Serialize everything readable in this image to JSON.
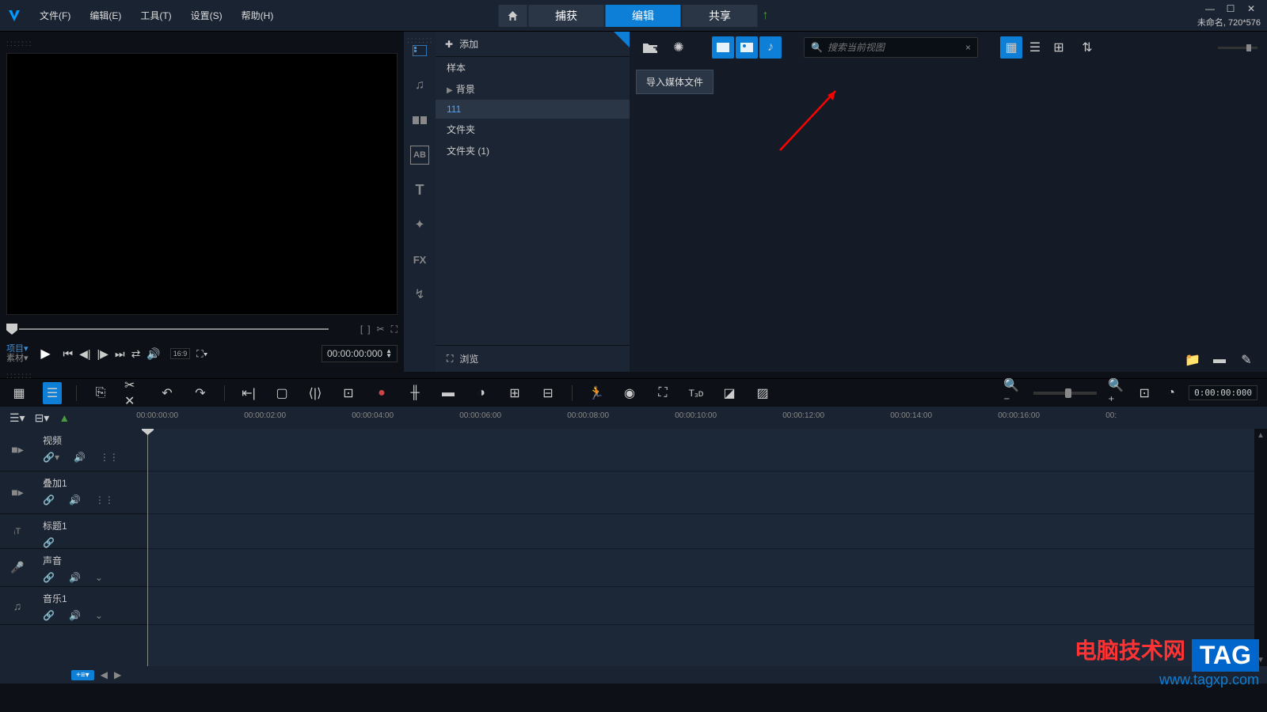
{
  "titlebar": {
    "menus": [
      "文件(F)",
      "编辑(E)",
      "工具(T)",
      "设置(S)",
      "帮助(H)"
    ],
    "tabs": {
      "capture": "捕获",
      "edit": "编辑",
      "share": "共享"
    },
    "project_info": "未命名, 720*576"
  },
  "preview": {
    "project_label": "项目▾",
    "material_label": "素材▾",
    "timecode": "00:00:00:000",
    "aspect": "16:9"
  },
  "library": {
    "add_label": "添加",
    "folders": [
      "样本",
      "背景",
      "111",
      "文件夹",
      "文件夹 (1)"
    ],
    "browse_label": "浏览",
    "search_placeholder": "搜索当前视图",
    "tooltip": "导入媒体文件"
  },
  "timeline": {
    "timecode": "0:00:00:000",
    "ruler": [
      "00:00:00:00",
      "00:00:02:00",
      "00:00:04:00",
      "00:00:06:00",
      "00:00:08:00",
      "00:00:10:00",
      "00:00:12:00",
      "00:00:14:00",
      "00:00:16:00",
      "00:"
    ],
    "tracks": [
      {
        "name": "视频",
        "icon": "video",
        "ctrls": [
          "link",
          "sound",
          "grid"
        ]
      },
      {
        "name": "叠加1",
        "icon": "video",
        "ctrls": [
          "link",
          "sound",
          "grid"
        ]
      },
      {
        "name": "标题1",
        "icon": "title",
        "ctrls": [
          "link"
        ]
      },
      {
        "name": "声音",
        "icon": "audio",
        "ctrls": [
          "link",
          "sound",
          "expand"
        ]
      },
      {
        "name": "音乐1",
        "icon": "music",
        "ctrls": [
          "link",
          "sound",
          "expand"
        ]
      }
    ]
  },
  "watermark": {
    "cn": "电脑技术网",
    "tag": "TAG",
    "url": "www.tagxp.com"
  }
}
